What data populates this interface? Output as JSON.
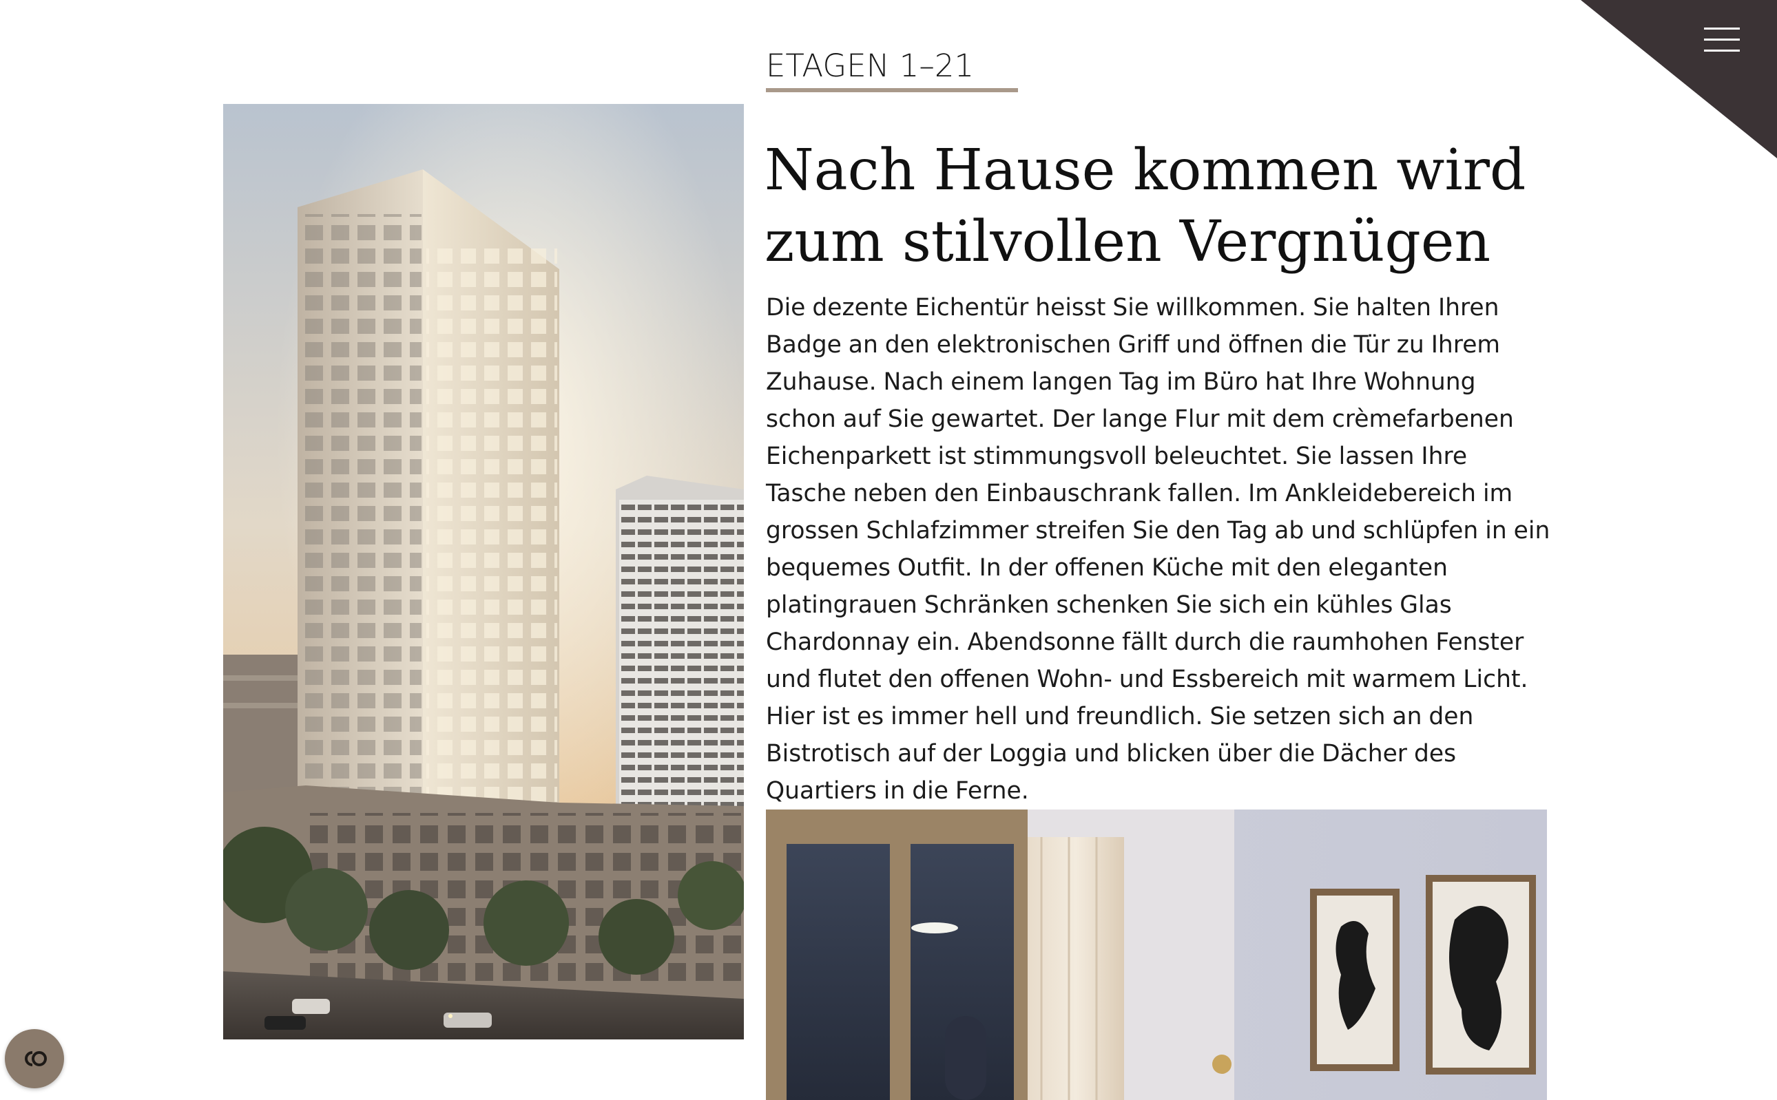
{
  "section": {
    "eyebrow": "ETAGEN 1–21",
    "headline": "Nach Hause kommen wird zum stilvollen Vergnügen",
    "body": "Die dezente Eichentür heisst Sie willkommen. Sie halten Ihren Badge an den elektronischen Griff und öffnen die Tür zu Ihrem Zuhause. Nach einem langen Tag im Büro hat Ihre Wohnung schon auf Sie gewartet. Der lange Flur mit dem crèmefarbenen Eichenparkett ist stimmungsvoll beleuchtet. Sie lassen Ihre Tasche neben den Einbauschrank fallen. Im Ankleidebereich im grossen Schlafzimmer streifen Sie den Tag ab und schlüpfen in ein bequemes Outfit. In der offenen Küche mit den eleganten platingrauen Schränken schenken Sie sich ein kühles Glas Chardonnay ein. Abendsonne fällt durch die raumhohen Fenster und flutet den offenen Wohn- und Essbereich mit warmem Licht. Hier ist es immer hell und freundlich. Sie setzen sich an den Bistrotisch auf der Loggia und blicken über die Dächer des Quartiers in die Ferne."
  },
  "icons": {
    "menu": "hamburger-menu-icon",
    "consent": "cookie-consent-icon"
  },
  "colors": {
    "corner": "#3b3335",
    "accent_rule": "#a9998a",
    "consent_badge": "#8a7a6b"
  }
}
